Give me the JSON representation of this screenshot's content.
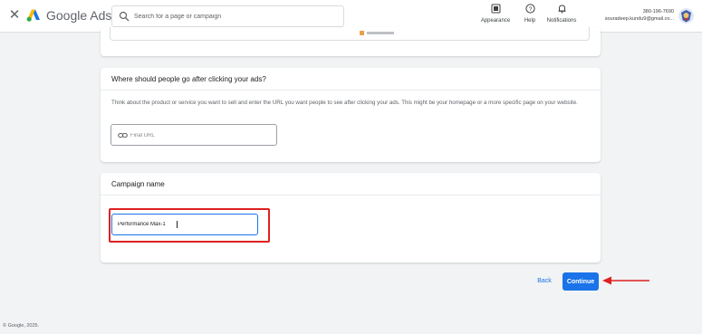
{
  "header": {
    "brand": "Google Ads",
    "search_placeholder": "Search for a page or campaign",
    "appearance_label": "Appearance",
    "help_label": "Help",
    "notifications_label": "Notifications",
    "account_id": "380-196-7690",
    "account_email": "souradeep.kundu9@gmail.co..."
  },
  "url_section": {
    "title": "Where should people go after clicking your ads?",
    "description": "Think about the product or service you want to sell and enter the URL you want people to see after clicking your ads. This might be your homepage or a more specific page on your website.",
    "final_url_placeholder": "Final URL",
    "final_url_value": ""
  },
  "campaign_section": {
    "title": "Campaign name",
    "name_value": "Performance Max-1"
  },
  "actions": {
    "back_label": "Back",
    "continue_label": "Continue"
  },
  "footer": {
    "copyright": "© Google, 2025."
  },
  "colors": {
    "primary": "#1a73e8",
    "highlight": "#e02020",
    "background": "#f1f3f4"
  }
}
